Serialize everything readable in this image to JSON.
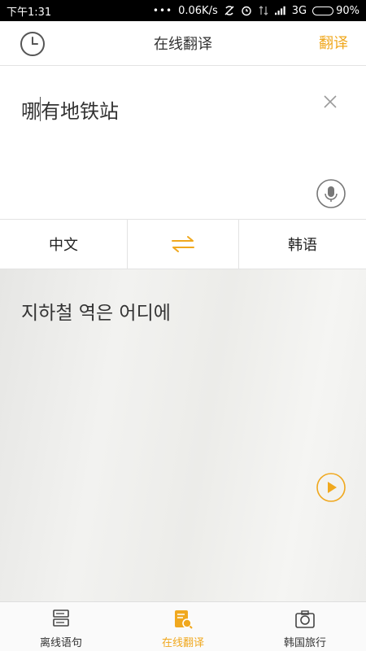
{
  "status": {
    "time": "下午1:31",
    "speed": "0.06K/s",
    "network": "3G",
    "battery": "90%",
    "battery_level": 0.9
  },
  "header": {
    "title": "在线翻译",
    "translate_label": "翻译",
    "accent_color": "#f0a81e"
  },
  "input": {
    "text": "哪有地铁站"
  },
  "languages": {
    "source": "中文",
    "target": "韩语"
  },
  "result": {
    "text": "지하철 역은 어디에"
  },
  "bottom_nav": {
    "items": [
      {
        "label": "离线语句",
        "icon": "phrasebook-icon"
      },
      {
        "label": "在线翻译",
        "icon": "online-translate-icon",
        "active": true
      },
      {
        "label": "韩国旅行",
        "icon": "camera-travel-icon"
      }
    ]
  }
}
